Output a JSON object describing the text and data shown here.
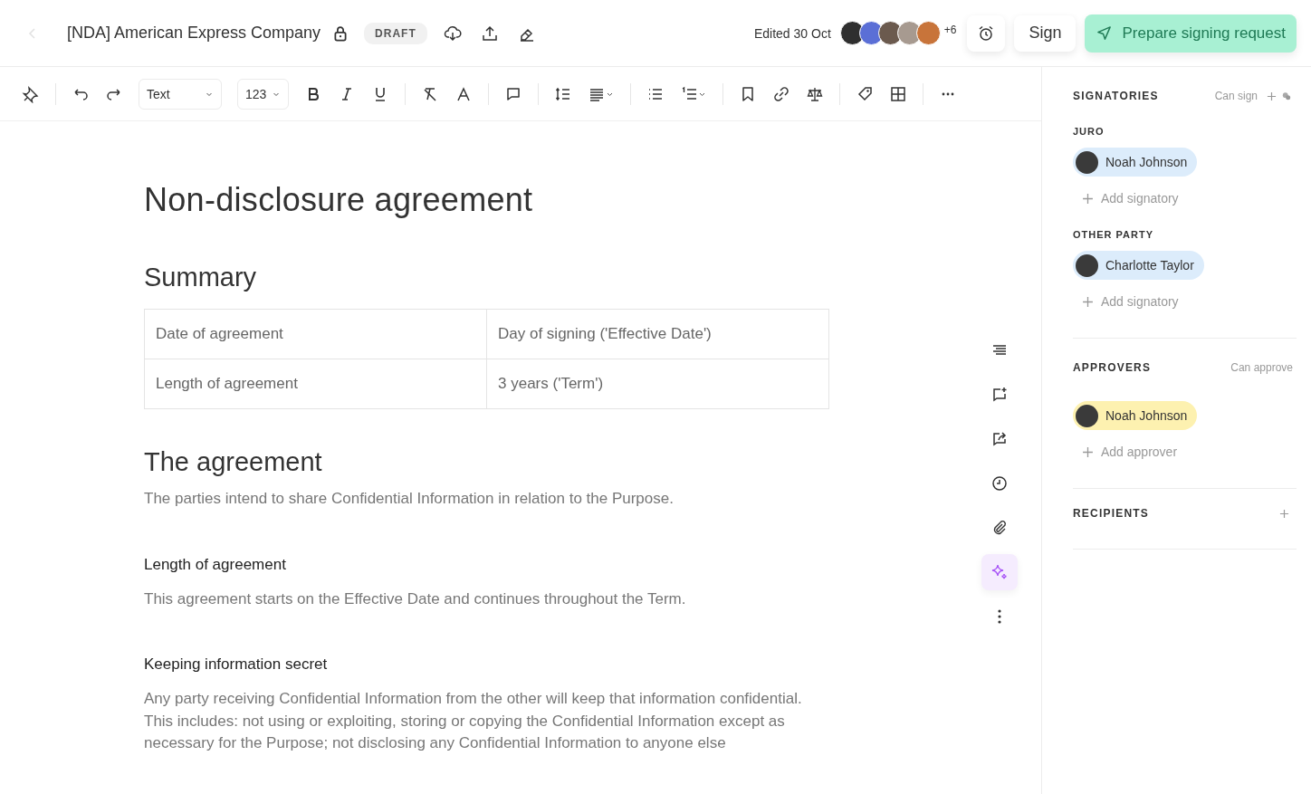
{
  "header": {
    "title": "[NDA] American Express Company",
    "status": "DRAFT",
    "edited": "Edited 30 Oct",
    "more_people": "+6",
    "sign_button": "Sign",
    "primary_button": "Prepare signing request"
  },
  "toolbar": {
    "style": "Text",
    "size": "123"
  },
  "document": {
    "title": "Non-disclosure agreement",
    "summary_heading": "Summary",
    "summary_table": [
      [
        "Date of agreement",
        "Day of signing ('Effective Date')"
      ],
      [
        "Length of agreement",
        "3 years ('Term')"
      ]
    ],
    "heading": "The agreement",
    "intro": "The parties intend to share Confidential Information in relation to the Purpose.",
    "sections": [
      {
        "heading": "Length of agreement",
        "body": "This agreement starts on the Effective Date and continues throughout the Term."
      },
      {
        "heading": "Keeping information secret",
        "body": "Any party receiving Confidential Information from the other will keep that information confidential. This includes: not using or exploiting, storing or copying the Confidential Information except as necessary for the Purpose; not disclosing any Confidential Information to anyone else"
      }
    ]
  },
  "side_rail": [
    {
      "selected": false
    },
    {
      "selected": false
    },
    {
      "selected": false
    },
    {
      "selected": false
    },
    {
      "selected": false
    },
    {
      "selected": true
    },
    {
      "selected": false
    }
  ],
  "panel": {
    "signatories": {
      "title": "SIGNATORIES",
      "hint": "Can sign",
      "groups": [
        {
          "label": "JURO",
          "people": [
            {
              "name": "Noah Johnson",
              "color": "#dcecfb"
            }
          ],
          "add": "Add signatory"
        },
        {
          "label": "OTHER PARTY",
          "people": [
            {
              "name": "Charlotte Taylor",
              "color": "#dcecfb"
            }
          ],
          "add": "Add signatory"
        }
      ]
    },
    "approvers": {
      "title": "APPROVERS",
      "hint": "Can approve",
      "people": [
        {
          "name": "Noah Johnson",
          "color": "#fdf1b0"
        }
      ],
      "add": "Add approver"
    },
    "recipients": {
      "title": "RECIPIENTS"
    }
  }
}
